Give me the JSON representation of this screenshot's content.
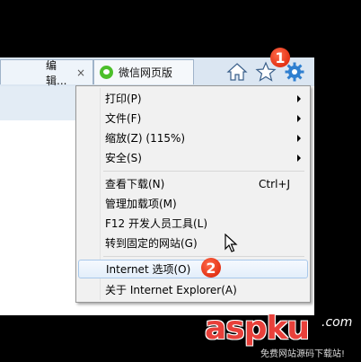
{
  "tabs": [
    {
      "label": "编辑...",
      "close": "×"
    },
    {
      "label": "微信网页版"
    }
  ],
  "menu": {
    "items": [
      {
        "label": "打印(P)",
        "submenu": true
      },
      {
        "label": "文件(F)",
        "submenu": true
      },
      {
        "label": "缩放(Z) (115%)",
        "submenu": true
      },
      {
        "label": "安全(S)",
        "submenu": true
      },
      {
        "label": "查看下载(N)",
        "shortcut": "Ctrl+J"
      },
      {
        "label": "管理加载项(M)"
      },
      {
        "label": "F12 开发人员工具(L)"
      },
      {
        "label": "转到固定的网站(G)"
      },
      {
        "label": "Internet 选项(O)",
        "highlighted": true
      },
      {
        "label": "关于 Internet Explorer(A)"
      }
    ]
  },
  "annotations": {
    "step1": "1",
    "step2": "2"
  },
  "watermark": {
    "brand": "aspku",
    "suffix": ".com",
    "tagline": "免费网站源码下载站!"
  },
  "colors": {
    "accent": "#e8403a",
    "menu_bg": "#f1f1f1",
    "highlight_border": "#a8c8ea"
  }
}
